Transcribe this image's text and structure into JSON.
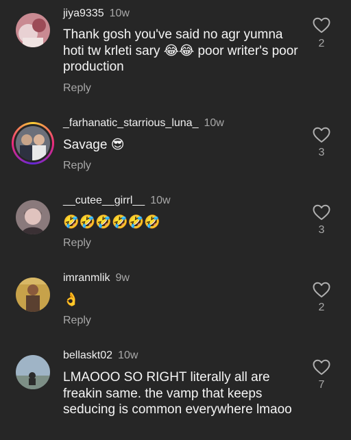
{
  "comments": [
    {
      "username": "jiya9335",
      "time": "10w",
      "text": "Thank gosh you've said no agr yumna hoti tw krleti sary 😂😂 poor writer's poor production",
      "reply_label": "Reply",
      "likes": "2",
      "avatar": "avatar-photo"
    },
    {
      "username": "_farhanatic_starrious_luna_",
      "time": "10w",
      "text": "Savage 😎",
      "reply_label": "Reply",
      "likes": "3",
      "avatar": "avatar-photo-story-ring"
    },
    {
      "username": "__cutee__girrl__",
      "time": "10w",
      "text": "🤣🤣🤣🤣🤣🤣",
      "reply_label": "Reply",
      "likes": "3",
      "avatar": "avatar-photo"
    },
    {
      "username": "imranmlik",
      "time": "9w",
      "text": "👌",
      "reply_label": "Reply",
      "likes": "2",
      "avatar": "avatar-photo"
    },
    {
      "username": "bellaskt02",
      "time": "10w",
      "text": "LMAOOO SO RIGHT literally all are freakin same. the vamp that keeps seducing is common everywhere lmaoo",
      "reply_label": "",
      "likes": "7",
      "avatar": "avatar-photo"
    }
  ],
  "icons": {
    "like": "heart-outline-icon"
  },
  "colors": {
    "background": "#262626",
    "secondary_text": "#a8a8a8",
    "primary_text": "#f5f5f5"
  }
}
